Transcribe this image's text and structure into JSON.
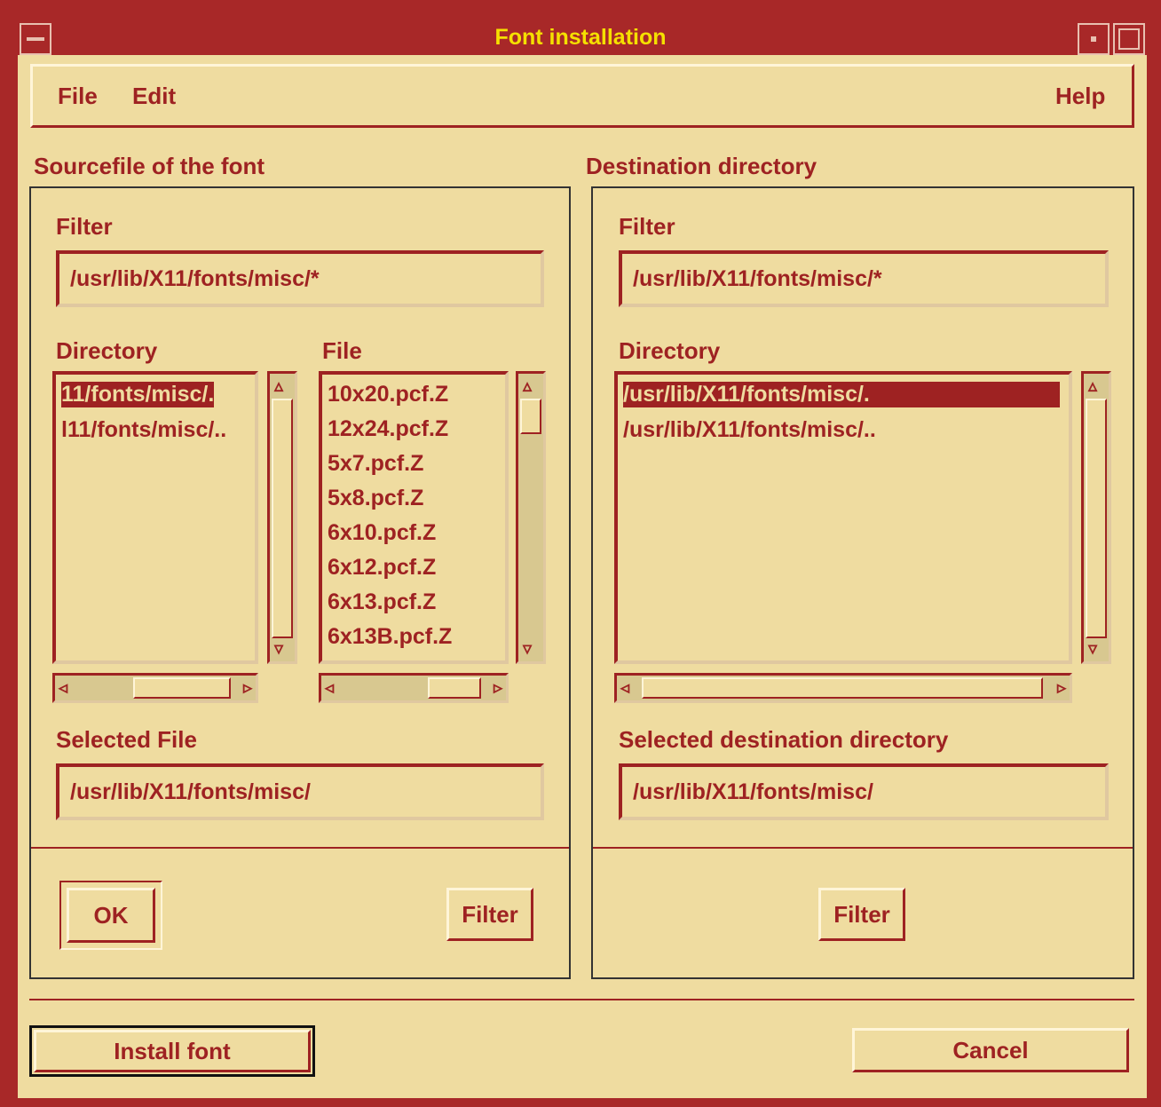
{
  "window": {
    "title": "Font installation"
  },
  "menu": {
    "file": "File",
    "edit": "Edit",
    "help": "Help"
  },
  "source": {
    "heading": "Sourcefile of the font",
    "filter_label": "Filter",
    "filter_value": "/usr/lib/X11/fonts/misc/*",
    "directory_label": "Directory",
    "directories": [
      "11/fonts/misc/.",
      "l11/fonts/misc/.."
    ],
    "file_label": "File",
    "files": [
      "10x20.pcf.Z",
      "12x24.pcf.Z",
      "5x7.pcf.Z",
      "5x8.pcf.Z",
      "6x10.pcf.Z",
      "6x12.pcf.Z",
      "6x13.pcf.Z",
      "6x13B.pcf.Z"
    ],
    "selected_label": "Selected File",
    "selected_value": "/usr/lib/X11/fonts/misc/",
    "ok": "OK",
    "filter_button": "Filter"
  },
  "destination": {
    "heading": "Destination directory",
    "filter_label": "Filter",
    "filter_value": "/usr/lib/X11/fonts/misc/*",
    "directory_label": "Directory",
    "directories": [
      "/usr/lib/X11/fonts/misc/.",
      "/usr/lib/X11/fonts/misc/.."
    ],
    "selected_label": "Selected destination directory",
    "selected_value": "/usr/lib/X11/fonts/misc/",
    "filter_button": "Filter"
  },
  "actions": {
    "install": "Install font",
    "cancel": "Cancel"
  }
}
